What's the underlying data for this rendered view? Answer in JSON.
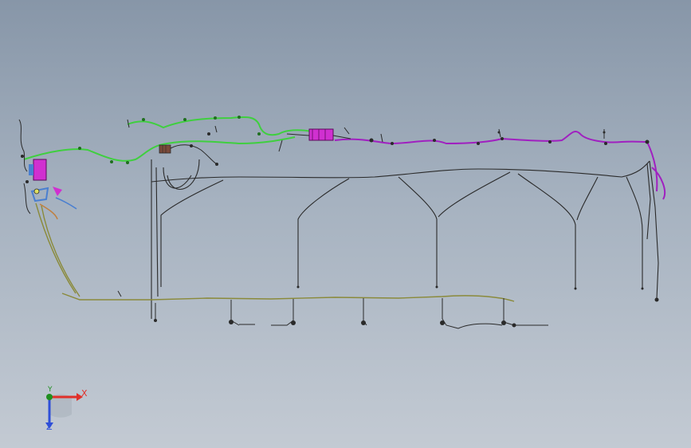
{
  "viewport": {
    "background_top": "#8796a8",
    "background_bottom": "#c3cad3"
  },
  "model": {
    "wire_color": "#2a2a2a",
    "green_harness_color": "#3fcf3f",
    "purple_harness_color": "#a020c0",
    "magenta_component_color": "#d030d0",
    "yellow_harness_color": "#8a8a3a",
    "blue_harness_color": "#4a7fd0"
  },
  "triad": {
    "x_label": "X",
    "y_label": "Y",
    "z_label": "Z",
    "x_color": "#e0302a",
    "y_color": "#1f8f1f",
    "z_color": "#2f4fd8"
  }
}
